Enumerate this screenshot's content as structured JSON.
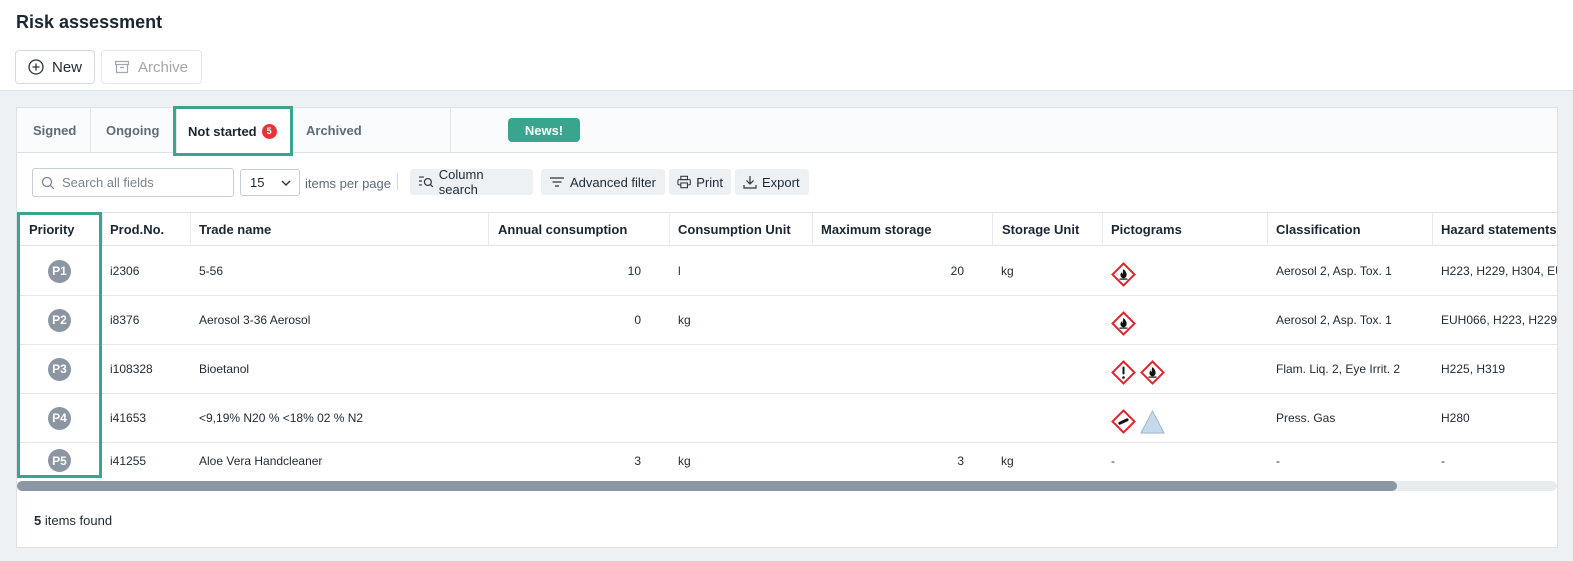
{
  "page": {
    "title": "Risk assessment"
  },
  "actions": {
    "new_label": "New",
    "archive_label": "Archive"
  },
  "tabs": [
    {
      "label": "Signed"
    },
    {
      "label": "Ongoing"
    },
    {
      "label": "Not started",
      "badge": "5"
    },
    {
      "label": "Archived"
    }
  ],
  "news_label": "News!",
  "toolbar": {
    "search_placeholder": "Search all fields",
    "per_page_value": "15",
    "per_page_label": "items per page",
    "column_search": "Column search",
    "advanced_filter": "Advanced filter",
    "print": "Print",
    "export": "Export"
  },
  "table": {
    "columns": [
      "Priority",
      "Prod.No.",
      "Trade name",
      "Annual consumption",
      "Consumption Unit",
      "Maximum storage",
      "Storage Unit",
      "Pictograms",
      "Classification",
      "Hazard statements"
    ],
    "rows": [
      {
        "priority": "P1",
        "prod_no": "i2306",
        "trade_name": "5-56",
        "annual": "10",
        "cons_unit": "l",
        "max_storage": "20",
        "storage_unit": "kg",
        "pictograms": [
          "flame-pictogram"
        ],
        "classification": "Aerosol 2, Asp. Tox. 1",
        "hazard": "H223, H229, H304, EU"
      },
      {
        "priority": "P2",
        "prod_no": "i8376",
        "trade_name": "Aerosol 3-36 Aerosol",
        "annual": "0",
        "cons_unit": "kg",
        "max_storage": "",
        "storage_unit": "",
        "pictograms": [
          "flame-pictogram"
        ],
        "classification": "Aerosol 2, Asp. Tox. 1",
        "hazard": "EUH066, H223, H229,"
      },
      {
        "priority": "P3",
        "prod_no": "i108328",
        "trade_name": "Bioetanol",
        "annual": "",
        "cons_unit": "",
        "max_storage": "",
        "storage_unit": "",
        "pictograms": [
          "exclamation-pictogram",
          "flame-pictogram"
        ],
        "classification": "Flam. Liq. 2, Eye Irrit. 2",
        "hazard": "H225, H319"
      },
      {
        "priority": "P4",
        "prod_no": "i41653",
        "trade_name": "<9,19% N20 % <18% 02 % N2",
        "annual": "",
        "cons_unit": "",
        "max_storage": "",
        "storage_unit": "",
        "pictograms": [
          "gas-cylinder-pictogram",
          "triangle-pictogram"
        ],
        "classification": "Press. Gas",
        "hazard": "H280"
      },
      {
        "priority": "P5",
        "prod_no": "i41255",
        "trade_name": "Aloe Vera Handcleaner",
        "annual": "3",
        "cons_unit": "kg",
        "max_storage": "3",
        "storage_unit": "kg",
        "pictograms": [],
        "pictogram_text": "-",
        "classification": "-",
        "hazard": "-"
      }
    ]
  },
  "footer": {
    "count": "5",
    "label": " items found"
  },
  "colors": {
    "accent": "#3aa58f",
    "badge": "#e8333a",
    "priority": "#8b96a2"
  }
}
